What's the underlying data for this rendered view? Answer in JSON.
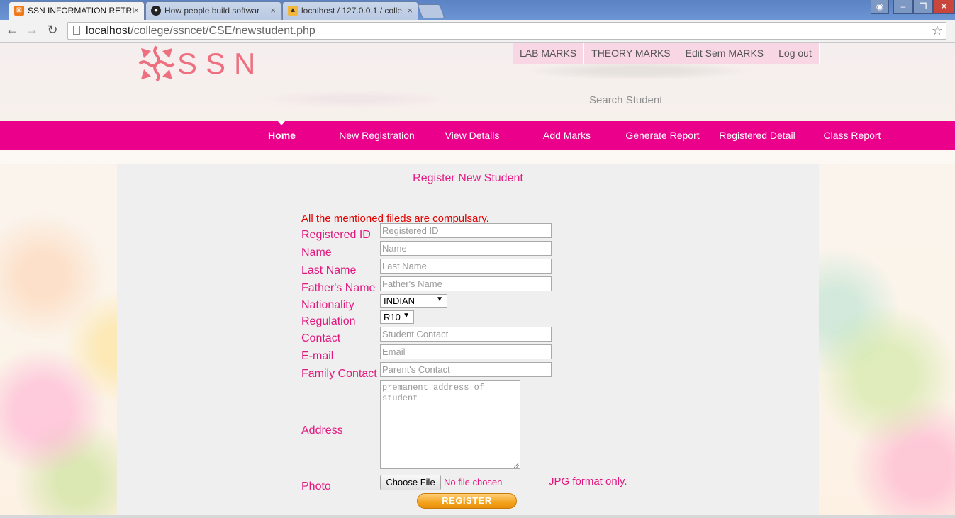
{
  "browser": {
    "tabs": [
      {
        "title": "SSN INFORMATION RETRI",
        "active": true,
        "icon": "xampp-icon"
      },
      {
        "title": "How people build softwar",
        "active": false,
        "icon": "github-icon"
      },
      {
        "title": "localhost / 127.0.0.1 / colle",
        "active": false,
        "icon": "phpmyadmin-icon"
      }
    ],
    "close_glyph": "×",
    "url_host": "localhost",
    "url_path": "/college/ssncet/CSE/newstudent.php"
  },
  "header": {
    "logo_text": "SSN",
    "top_links": [
      "LAB MARKS",
      "THEORY MARKS",
      "Edit Sem MARKS",
      "Log out"
    ],
    "search_label": "Search Student"
  },
  "nav": {
    "items": [
      "Home",
      "New Registration",
      "View Details",
      "Add Marks",
      "Generate Report",
      "Registered Detail",
      "Class Report"
    ],
    "active": "Home"
  },
  "form": {
    "title": "Register New Student",
    "notice": "All the mentioned fileds are compulsary.",
    "fields": {
      "registered_id": {
        "label": "Registered ID",
        "placeholder": "Registered ID"
      },
      "name": {
        "label": "Name",
        "placeholder": "Name"
      },
      "last_name": {
        "label": "Last Name",
        "placeholder": "Last Name"
      },
      "father_name": {
        "label": "Father's Name",
        "placeholder": "Father's Name"
      },
      "nationality": {
        "label": "Nationality",
        "value": "INDIAN"
      },
      "regulation": {
        "label": "Regulation",
        "value": "R10"
      },
      "contact": {
        "label": "Contact",
        "placeholder": "Student Contact"
      },
      "email": {
        "label": "E-mail",
        "placeholder": "Email"
      },
      "family_contact": {
        "label": "Family Contact",
        "placeholder": "Parent's Contact"
      },
      "address": {
        "label": "Address",
        "placeholder": "premanent address of student"
      },
      "photo": {
        "label": "Photo",
        "button": "Choose File",
        "status": "No file chosen",
        "note": "JPG format only."
      }
    },
    "submit_label": "REGISTER"
  },
  "colors": {
    "brand_pink": "#ea008b",
    "label_pink": "#e3187f",
    "notice_red": "#e30000",
    "button_orange": "#f3a21c"
  }
}
